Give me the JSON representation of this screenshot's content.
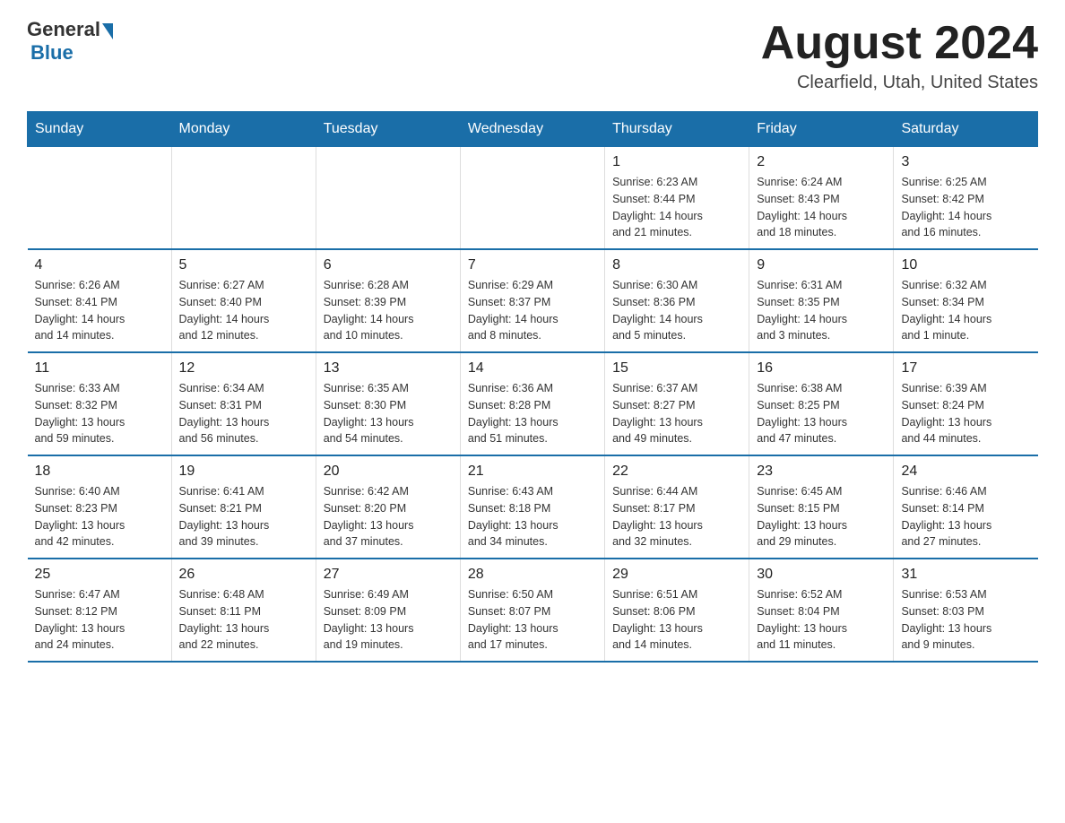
{
  "logo": {
    "text_general": "General",
    "text_blue": "Blue"
  },
  "title": {
    "month_year": "August 2024",
    "location": "Clearfield, Utah, United States"
  },
  "days_of_week": [
    "Sunday",
    "Monday",
    "Tuesday",
    "Wednesday",
    "Thursday",
    "Friday",
    "Saturday"
  ],
  "weeks": [
    [
      {
        "day": "",
        "info": ""
      },
      {
        "day": "",
        "info": ""
      },
      {
        "day": "",
        "info": ""
      },
      {
        "day": "",
        "info": ""
      },
      {
        "day": "1",
        "info": "Sunrise: 6:23 AM\nSunset: 8:44 PM\nDaylight: 14 hours\nand 21 minutes."
      },
      {
        "day": "2",
        "info": "Sunrise: 6:24 AM\nSunset: 8:43 PM\nDaylight: 14 hours\nand 18 minutes."
      },
      {
        "day": "3",
        "info": "Sunrise: 6:25 AM\nSunset: 8:42 PM\nDaylight: 14 hours\nand 16 minutes."
      }
    ],
    [
      {
        "day": "4",
        "info": "Sunrise: 6:26 AM\nSunset: 8:41 PM\nDaylight: 14 hours\nand 14 minutes."
      },
      {
        "day": "5",
        "info": "Sunrise: 6:27 AM\nSunset: 8:40 PM\nDaylight: 14 hours\nand 12 minutes."
      },
      {
        "day": "6",
        "info": "Sunrise: 6:28 AM\nSunset: 8:39 PM\nDaylight: 14 hours\nand 10 minutes."
      },
      {
        "day": "7",
        "info": "Sunrise: 6:29 AM\nSunset: 8:37 PM\nDaylight: 14 hours\nand 8 minutes."
      },
      {
        "day": "8",
        "info": "Sunrise: 6:30 AM\nSunset: 8:36 PM\nDaylight: 14 hours\nand 5 minutes."
      },
      {
        "day": "9",
        "info": "Sunrise: 6:31 AM\nSunset: 8:35 PM\nDaylight: 14 hours\nand 3 minutes."
      },
      {
        "day": "10",
        "info": "Sunrise: 6:32 AM\nSunset: 8:34 PM\nDaylight: 14 hours\nand 1 minute."
      }
    ],
    [
      {
        "day": "11",
        "info": "Sunrise: 6:33 AM\nSunset: 8:32 PM\nDaylight: 13 hours\nand 59 minutes."
      },
      {
        "day": "12",
        "info": "Sunrise: 6:34 AM\nSunset: 8:31 PM\nDaylight: 13 hours\nand 56 minutes."
      },
      {
        "day": "13",
        "info": "Sunrise: 6:35 AM\nSunset: 8:30 PM\nDaylight: 13 hours\nand 54 minutes."
      },
      {
        "day": "14",
        "info": "Sunrise: 6:36 AM\nSunset: 8:28 PM\nDaylight: 13 hours\nand 51 minutes."
      },
      {
        "day": "15",
        "info": "Sunrise: 6:37 AM\nSunset: 8:27 PM\nDaylight: 13 hours\nand 49 minutes."
      },
      {
        "day": "16",
        "info": "Sunrise: 6:38 AM\nSunset: 8:25 PM\nDaylight: 13 hours\nand 47 minutes."
      },
      {
        "day": "17",
        "info": "Sunrise: 6:39 AM\nSunset: 8:24 PM\nDaylight: 13 hours\nand 44 minutes."
      }
    ],
    [
      {
        "day": "18",
        "info": "Sunrise: 6:40 AM\nSunset: 8:23 PM\nDaylight: 13 hours\nand 42 minutes."
      },
      {
        "day": "19",
        "info": "Sunrise: 6:41 AM\nSunset: 8:21 PM\nDaylight: 13 hours\nand 39 minutes."
      },
      {
        "day": "20",
        "info": "Sunrise: 6:42 AM\nSunset: 8:20 PM\nDaylight: 13 hours\nand 37 minutes."
      },
      {
        "day": "21",
        "info": "Sunrise: 6:43 AM\nSunset: 8:18 PM\nDaylight: 13 hours\nand 34 minutes."
      },
      {
        "day": "22",
        "info": "Sunrise: 6:44 AM\nSunset: 8:17 PM\nDaylight: 13 hours\nand 32 minutes."
      },
      {
        "day": "23",
        "info": "Sunrise: 6:45 AM\nSunset: 8:15 PM\nDaylight: 13 hours\nand 29 minutes."
      },
      {
        "day": "24",
        "info": "Sunrise: 6:46 AM\nSunset: 8:14 PM\nDaylight: 13 hours\nand 27 minutes."
      }
    ],
    [
      {
        "day": "25",
        "info": "Sunrise: 6:47 AM\nSunset: 8:12 PM\nDaylight: 13 hours\nand 24 minutes."
      },
      {
        "day": "26",
        "info": "Sunrise: 6:48 AM\nSunset: 8:11 PM\nDaylight: 13 hours\nand 22 minutes."
      },
      {
        "day": "27",
        "info": "Sunrise: 6:49 AM\nSunset: 8:09 PM\nDaylight: 13 hours\nand 19 minutes."
      },
      {
        "day": "28",
        "info": "Sunrise: 6:50 AM\nSunset: 8:07 PM\nDaylight: 13 hours\nand 17 minutes."
      },
      {
        "day": "29",
        "info": "Sunrise: 6:51 AM\nSunset: 8:06 PM\nDaylight: 13 hours\nand 14 minutes."
      },
      {
        "day": "30",
        "info": "Sunrise: 6:52 AM\nSunset: 8:04 PM\nDaylight: 13 hours\nand 11 minutes."
      },
      {
        "day": "31",
        "info": "Sunrise: 6:53 AM\nSunset: 8:03 PM\nDaylight: 13 hours\nand 9 minutes."
      }
    ]
  ]
}
